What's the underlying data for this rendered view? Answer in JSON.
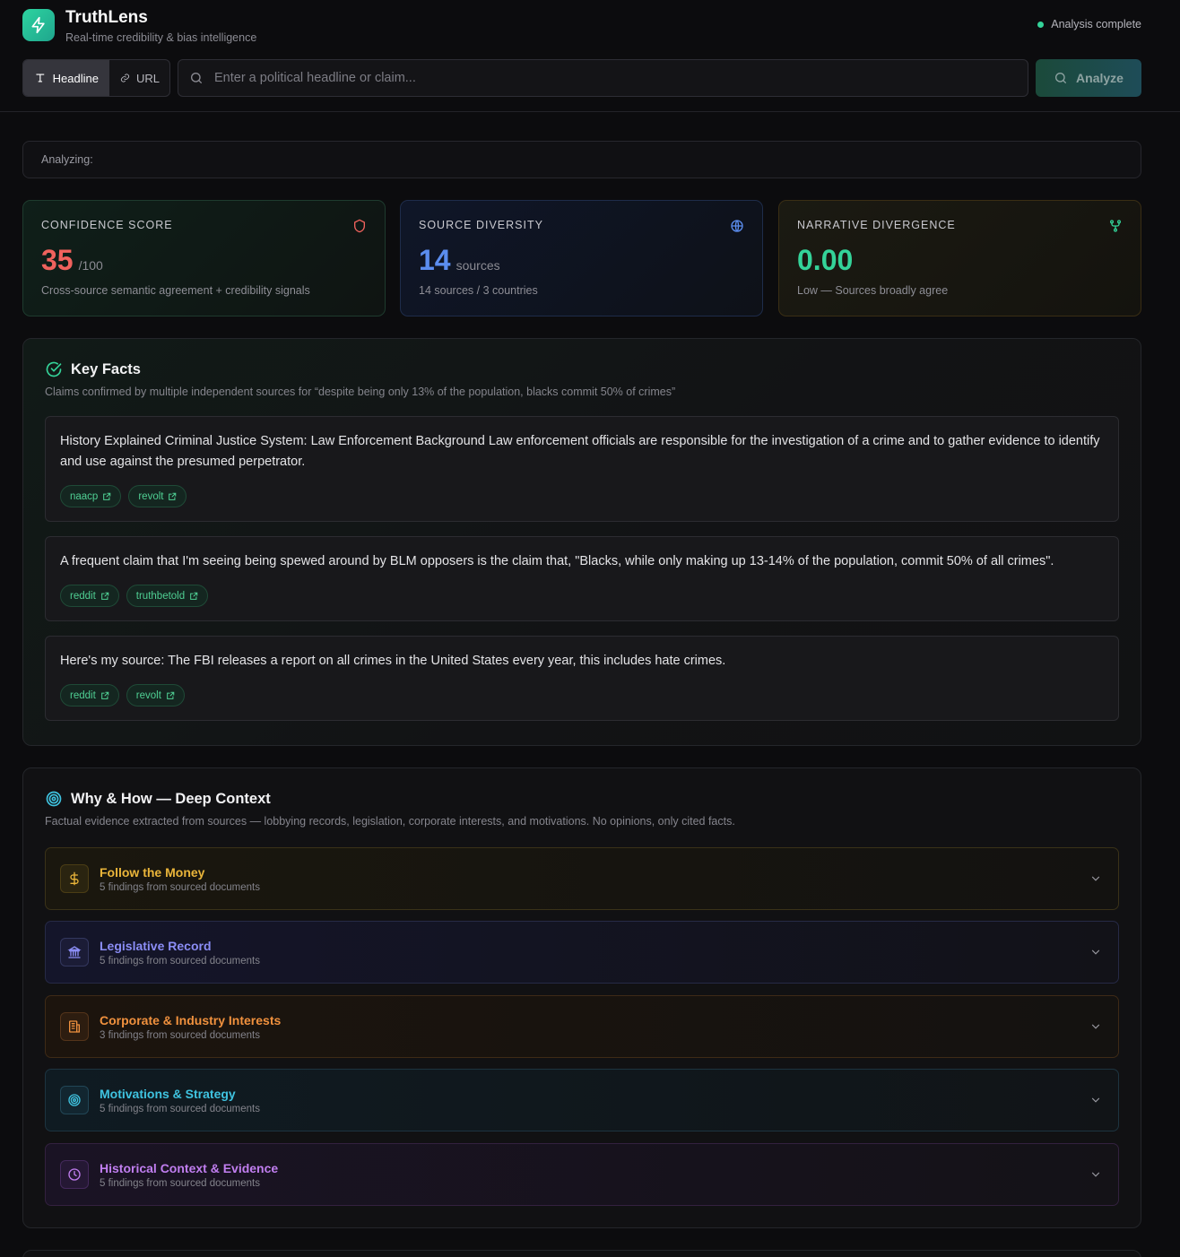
{
  "header": {
    "app_title": "TruthLens",
    "app_subtitle": "Real-time credibility & bias intelligence",
    "status_text": "Analysis complete"
  },
  "search": {
    "mode_headline": "Headline",
    "mode_url": "URL",
    "placeholder": "Enter a political headline or claim...",
    "value": "",
    "analyze_label": "Analyze"
  },
  "analyzing": {
    "label": "Analyzing:"
  },
  "stats": {
    "confidence": {
      "label": "CONFIDENCE SCORE",
      "value": "35",
      "unit": "/100",
      "desc": "Cross-source semantic agreement + credibility signals",
      "color": "#f0625d",
      "icon": "shield-icon"
    },
    "diversity": {
      "label": "SOURCE DIVERSITY",
      "value": "14",
      "unit": "sources",
      "desc": "14 sources / 3 countries",
      "color": "#5b8def",
      "icon": "globe-icon"
    },
    "divergence": {
      "label": "NARRATIVE DIVERGENCE",
      "value": "0.00",
      "unit": "",
      "desc": "Low — Sources broadly agree",
      "color": "#34d399",
      "icon": "git-fork-icon"
    }
  },
  "key_facts": {
    "title": "Key Facts",
    "subtitle": "Claims confirmed by multiple independent sources for “despite being only 13% of the population, blacks commit 50% of crimes”",
    "facts": [
      {
        "text": "History Explained Criminal Justice System: Law Enforcement Background Law enforcement officials are responsible for the investigation of a crime and to gather evidence to identify and use against the presumed perpetrator.",
        "sources": [
          "naacp",
          "revolt"
        ]
      },
      {
        "text": "A frequent claim that I'm seeing being spewed around by BLM opposers is the claim that, \"Blacks, while only making up 13-14% of the population, commit 50% of all crimes\".",
        "sources": [
          "reddit",
          "truthbetold"
        ]
      },
      {
        "text": "Here's my source: The FBI releases a report on all crimes in the United States every year, this includes hate crimes.",
        "sources": [
          "reddit",
          "revolt"
        ]
      }
    ]
  },
  "context": {
    "title": "Why & How — Deep Context",
    "subtitle": "Factual evidence extracted from sources — lobbying records, legislation, corporate interests, and motivations. No opinions, only cited facts.",
    "sections": [
      {
        "title": "Follow the Money",
        "count": "5 findings from sourced documents",
        "icon": "dollar-icon",
        "color": "#eab53a"
      },
      {
        "title": "Legislative Record",
        "count": "5 findings from sourced documents",
        "icon": "landmark-icon",
        "color": "#8b8df5"
      },
      {
        "title": "Corporate & Industry Interests",
        "count": "3 findings from sourced documents",
        "icon": "building-icon",
        "color": "#f0913e"
      },
      {
        "title": "Motivations & Strategy",
        "count": "5 findings from sourced documents",
        "icon": "target-icon",
        "color": "#3fc3e0"
      },
      {
        "title": "Historical Context & Evidence",
        "count": "5 findings from sourced documents",
        "icon": "clock-icon",
        "color": "#c17ef0"
      }
    ]
  }
}
